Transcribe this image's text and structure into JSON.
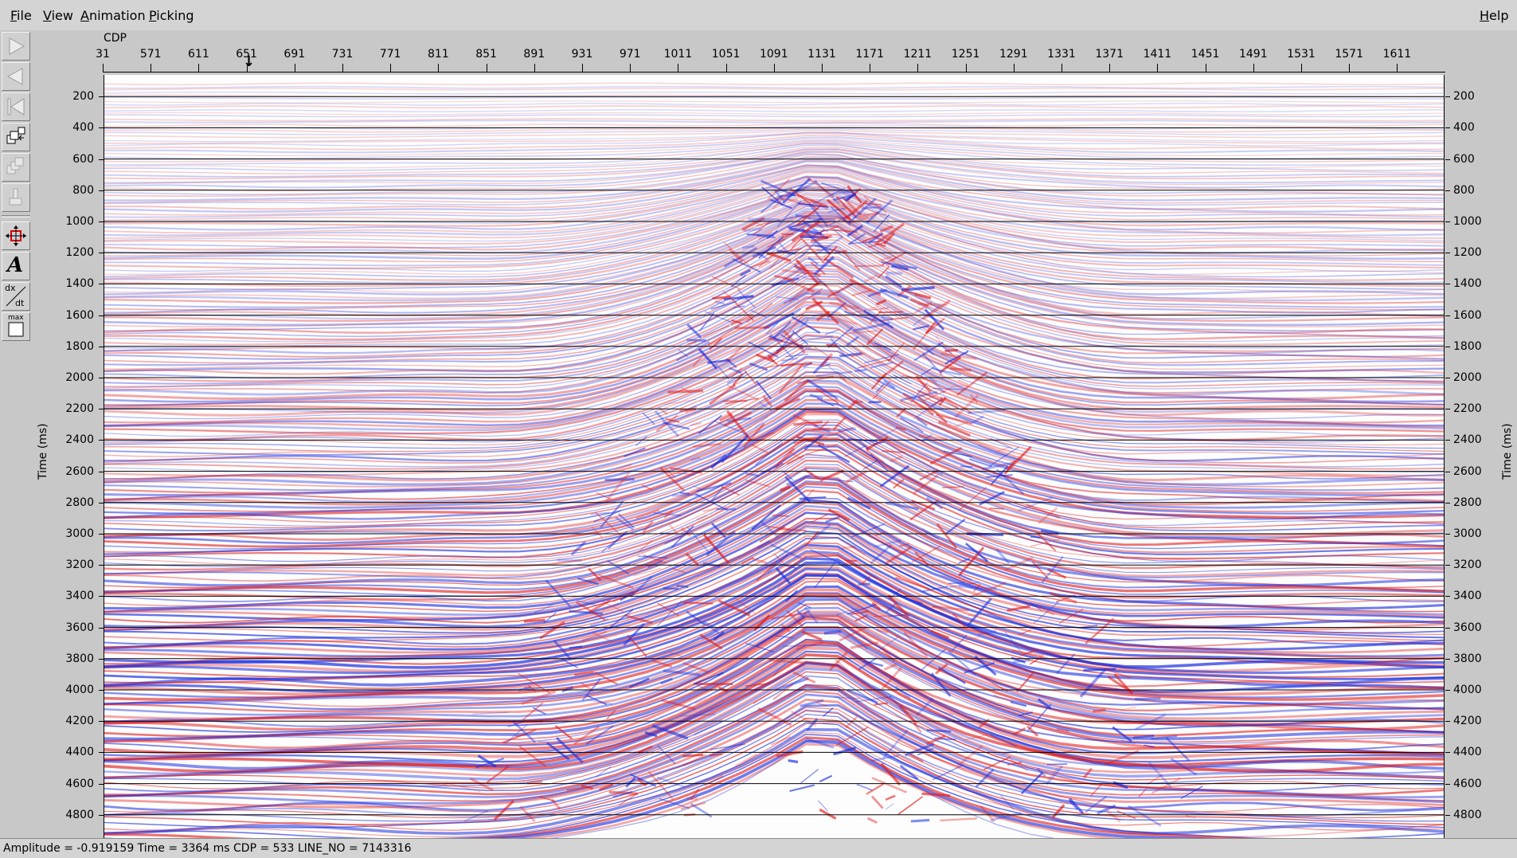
{
  "menubar": {
    "file": "File",
    "view": "View",
    "animation": "Animation",
    "picking": "Picking",
    "help": "Help"
  },
  "toolbar": {
    "buttons": [
      {
        "name": "play-forward-icon",
        "enabled": false
      },
      {
        "name": "play-backward-icon",
        "enabled": false
      },
      {
        "name": "rewind-to-start-icon",
        "enabled": false
      },
      {
        "name": "window-swap-icon",
        "enabled": true
      },
      {
        "name": "window-stack-icon",
        "enabled": false
      },
      {
        "name": "brush-icon",
        "enabled": false
      },
      {
        "name": "pan-zoom-icon",
        "enabled": true
      },
      {
        "name": "annotate-text-icon",
        "enabled": true
      },
      {
        "name": "velocity-dx-dt-icon",
        "enabled": true
      },
      {
        "name": "max-amplitude-icon",
        "enabled": true
      }
    ],
    "annotate_glyph": "A",
    "dxdt_top": "dx",
    "dxdt_bottom": "dt",
    "max_label": "max"
  },
  "x_axis": {
    "label": "CDP",
    "ticks": [
      "31",
      "571",
      "611",
      "651",
      "691",
      "731",
      "771",
      "811",
      "851",
      "891",
      "931",
      "971",
      "1011",
      "1051",
      "1091",
      "1131",
      "1171",
      "1211",
      "1251",
      "1291",
      "1331",
      "1371",
      "1411",
      "1451",
      "1491",
      "1531",
      "1571",
      "1611"
    ],
    "cursor_cdp": 651
  },
  "y_axis": {
    "label": "Time (ms)",
    "ticks": [
      "200",
      "400",
      "600",
      "800",
      "1000",
      "1200",
      "1400",
      "1600",
      "1800",
      "2000",
      "2200",
      "2400",
      "2600",
      "2800",
      "3000",
      "3200",
      "3400",
      "3600",
      "3800",
      "4000",
      "4200",
      "4400",
      "4600",
      "4800"
    ],
    "range_ms": [
      0,
      5000
    ]
  },
  "display": {
    "colormap": "red-white-blue",
    "positive_color": "#e21a1a",
    "negative_color": "#1a2ee0",
    "background_color": "#ffffff",
    "timing_lines": true
  },
  "status": {
    "text": "Amplitude = -0.919159  Time = 3364 ms  CDP = 533  LINE_NO = 7143316"
  }
}
